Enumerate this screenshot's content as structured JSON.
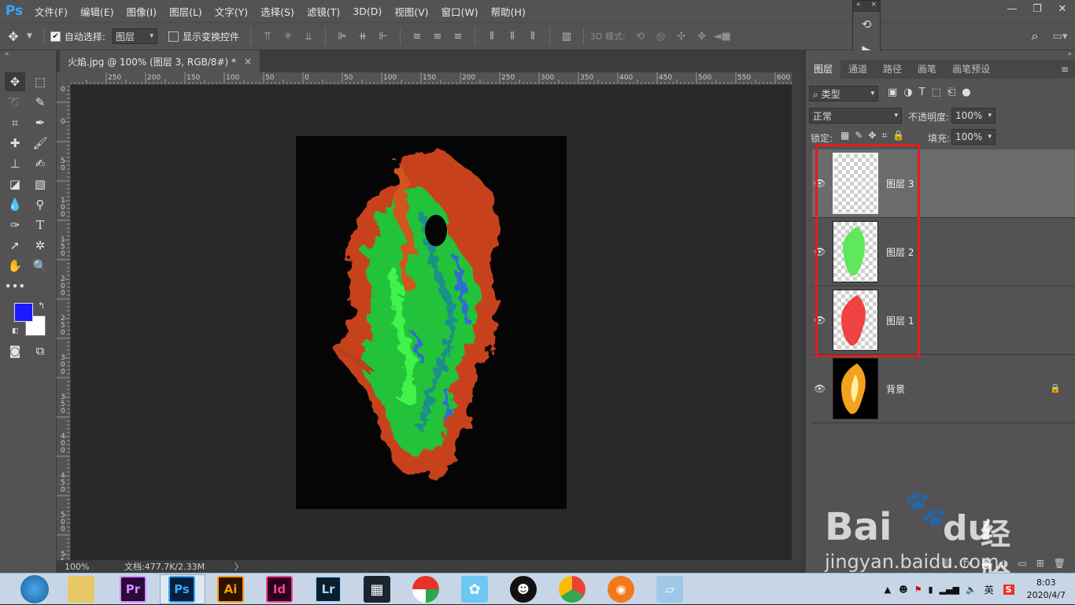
{
  "app": {
    "logo": "Ps",
    "menus": [
      "文件(F)",
      "编辑(E)",
      "图像(I)",
      "图层(L)",
      "文字(Y)",
      "选择(S)",
      "滤镜(T)",
      "3D(D)",
      "视图(V)",
      "窗口(W)",
      "帮助(H)"
    ]
  },
  "options": {
    "auto_select_label": "自动选择:",
    "auto_select_target": "图层",
    "show_transform_label": "显示变换控件",
    "mode_3d_label": "3D 模式:"
  },
  "document": {
    "tab_title": "火焰.jpg @ 100% (图层 3, RGB/8#) *",
    "close": "×",
    "zoom": "100%",
    "doc_info": "文档:477.7K/2.33M",
    "status_arrow": "〉"
  },
  "rulers": {
    "h_labels": [
      "250",
      "200",
      "150",
      "100",
      "50",
      "0",
      "50",
      "100",
      "150",
      "200",
      "250",
      "300",
      "350",
      "400",
      "450",
      "500",
      "550",
      "600"
    ],
    "v_labels": [
      "5\n0",
      "0",
      "5\n0",
      "1\n0\n0",
      "1\n5\n0",
      "2\n0\n0",
      "2\n5\n0",
      "3\n0\n0",
      "3\n5\n0",
      "4\n0\n0",
      "4\n5\n0",
      "5\n0\n0",
      "5\n5\n0"
    ]
  },
  "layers_panel": {
    "tabs": [
      "图层",
      "通道",
      "路径",
      "画笔",
      "画笔预设"
    ],
    "filter_kind": "类型",
    "blend_mode": "正常",
    "opacity_label": "不透明度:",
    "opacity_value": "100%",
    "lock_label": "锁定:",
    "fill_label": "填充:",
    "fill_value": "100%",
    "layers": [
      {
        "name": "图层 3",
        "selected": true
      },
      {
        "name": "图层 2",
        "selected": false
      },
      {
        "name": "图层 1",
        "selected": false
      },
      {
        "name": "背景",
        "selected": false,
        "locked": true
      }
    ]
  },
  "taskbar": {
    "apps": [
      "Pr",
      "Ps",
      "Ai",
      "Id",
      "Lr"
    ],
    "ime": "英",
    "time": "8:03",
    "date": "2020/4/7"
  },
  "watermark": {
    "brand": "Bai",
    "brand2": "du",
    "cn": "经验",
    "url": "jingyan.baidu.com"
  },
  "colors": {
    "foreground": "#1a1aff",
    "background": "#ffffff",
    "highlight_box": "#e01f1f",
    "ps_blue": "#31a8ff"
  }
}
